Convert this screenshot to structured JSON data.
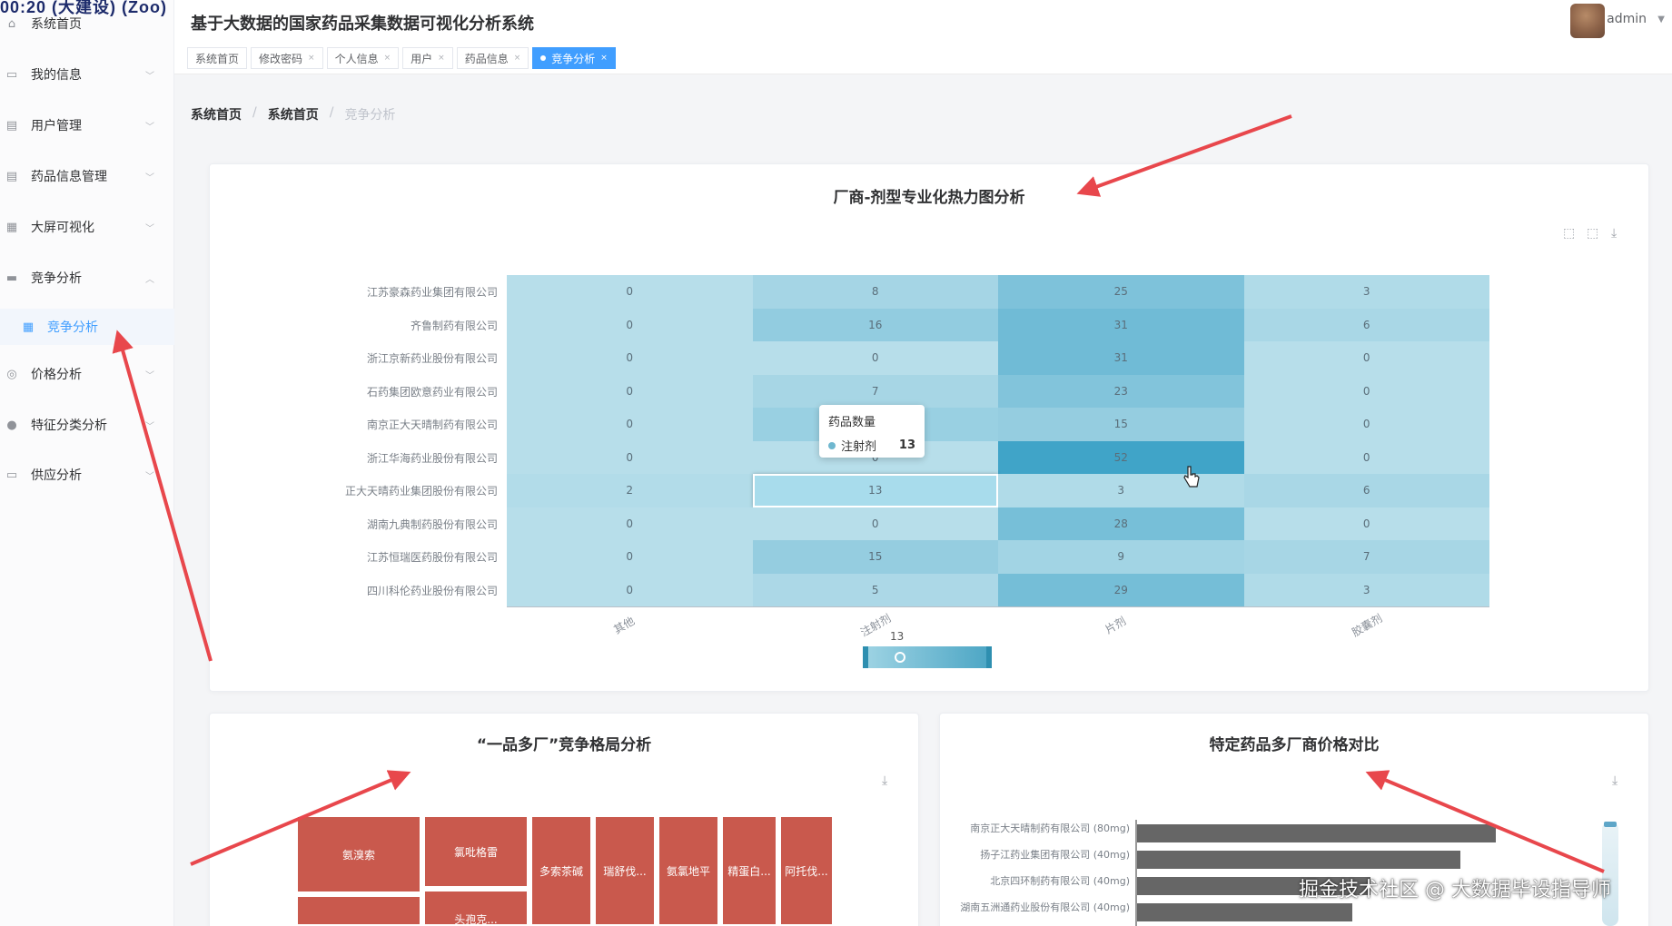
{
  "sidebar": {
    "stamp": "00:20 (大建设) (Zoo)",
    "items": [
      {
        "label": "系统首页",
        "icon": "home-icon",
        "has_arrow": false
      },
      {
        "label": "我的信息",
        "icon": "card-icon",
        "has_arrow": true
      },
      {
        "label": "用户管理",
        "icon": "clipboard-icon",
        "has_arrow": true
      },
      {
        "label": "药品信息管理",
        "icon": "clipboard-icon",
        "has_arrow": true
      },
      {
        "label": "大屏可视化",
        "icon": "grid-icon",
        "has_arrow": true
      },
      {
        "label": "竞争分析",
        "icon": "ticket-icon",
        "has_arrow": true
      },
      {
        "label": "竞争分析",
        "icon": "grid-icon",
        "has_arrow": false,
        "sub": true,
        "active": true
      },
      {
        "label": "价格分析",
        "icon": "coin-icon",
        "has_arrow": true
      },
      {
        "label": "特征分类分析",
        "icon": "user-icon",
        "has_arrow": true
      },
      {
        "label": "供应分析",
        "icon": "monitor-icon",
        "has_arrow": true
      }
    ]
  },
  "header": {
    "title": "基于大数据的国家药品采集数据可视化分析系统",
    "user": "admin",
    "tabs": [
      {
        "label": "系统首页",
        "closable": false
      },
      {
        "label": "修改密码",
        "closable": true
      },
      {
        "label": "个人信息",
        "closable": true
      },
      {
        "label": "用户",
        "closable": true
      },
      {
        "label": "药品信息",
        "closable": true
      },
      {
        "label": "竞争分析",
        "closable": true,
        "active": true
      }
    ]
  },
  "breadcrumb": {
    "a": "系统首页",
    "b": "系统首页",
    "current": "竞争分析",
    "sep": "/"
  },
  "heatmap_card": {
    "title": "厂商-剂型专业化热力图分析"
  },
  "chart_data": [
    {
      "type": "heatmap",
      "title": "厂商-剂型专业化热力图分析",
      "x": [
        "其他",
        "注射剂",
        "片剂",
        "胶囊剂"
      ],
      "y": [
        "江苏豪森药业集团有限公司",
        "齐鲁制药有限公司",
        "浙江京新药业股份有限公司",
        "石药集团欧意药业有限公司",
        "南京正大天晴制药有限公司",
        "浙江华海药业股份有限公司",
        "正大天晴药业集团股份有限公司",
        "湖南九典制药股份有限公司",
        "江苏恒瑞医药股份有限公司",
        "四川科伦药业股份有限公司"
      ],
      "values": [
        [
          0,
          8,
          25,
          3
        ],
        [
          0,
          16,
          31,
          6
        ],
        [
          0,
          0,
          31,
          0
        ],
        [
          0,
          7,
          23,
          0
        ],
        [
          0,
          13,
          15,
          0
        ],
        [
          0,
          0,
          52,
          0
        ],
        [
          2,
          13,
          3,
          6
        ],
        [
          0,
          0,
          28,
          0
        ],
        [
          0,
          15,
          9,
          7
        ],
        [
          0,
          5,
          29,
          3
        ]
      ],
      "tooltip": {
        "title": "药品数量",
        "series": "注射剂",
        "value": 13
      },
      "visual_map_value": 13
    },
    {
      "type": "treemap",
      "title": "“一品多厂”竞争格局分析",
      "items": [
        "氨溴索",
        "氯吡格雷",
        "多索茶碱",
        "瑞舒伐...",
        "氨氯地平",
        "精蛋白...",
        "阿托伐...",
        "头孢克..."
      ]
    },
    {
      "type": "bar",
      "title": "特定药品多厂商价格对比",
      "categories": [
        "南京正大天晴制药有限公司 (80mg)",
        "扬子江药业集团有限公司 (40mg)",
        "北京四环制药有限公司 (40mg)",
        "湖南五洲通药业股份有限公司 (40mg)"
      ],
      "values": [
        100,
        90,
        65,
        60
      ]
    }
  ],
  "treemap_card": {
    "title": "“一品多厂”竞争格局分析"
  },
  "bar_card": {
    "title": "特定药品多厂商价格对比"
  },
  "watermark": "掘金技术社区 @ 大数据毕设指导师",
  "colors": {
    "accent": "#409eff",
    "arrow": "#e8474c",
    "treemap": "#c9594d",
    "bar": "#666666"
  }
}
